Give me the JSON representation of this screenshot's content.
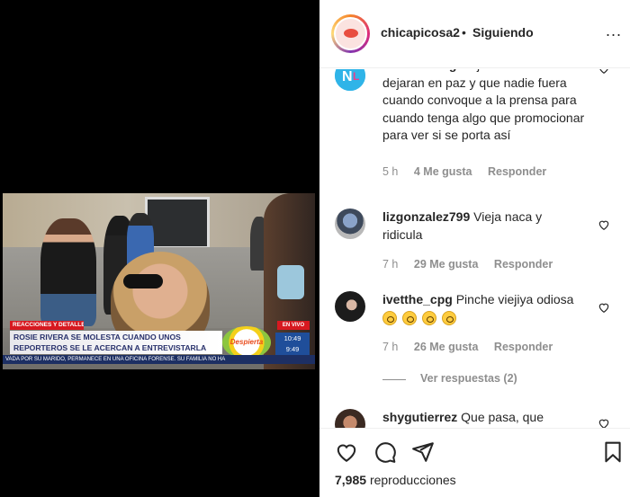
{
  "video": {
    "section_label": "REACCIONES Y DETALLES",
    "live_label": "EN VIVO",
    "headline": "ROSIE RIVERA SE MOLESTA CUANDO UNOS REPORTEROS SE LE ACERCAN A ENTREVISTARLA",
    "show_logo": "Despierta",
    "clock_time": "10:49",
    "clock_temp": "9:49",
    "ticker": "VADA POR SU MARIDO, PERMANECE EN UNA OFICINA FORENSE. SU FAMILIA NO HA"
  },
  "post": {
    "username": "chicapicosa2",
    "separator": "•",
    "follow_label": "Siguiendo",
    "more_label": "...",
    "views_count": "7,985",
    "views_label": "reproducciones"
  },
  "comments": [
    {
      "user": "novelalounge",
      "text": "Ojalá un día si la dejaran en paz y que nadie fuera cuando convoque a la prensa para cuando tenga algo que promocionar para ver si se porta así",
      "time": "5 h",
      "likes": "4 Me gusta",
      "reply": "Responder"
    },
    {
      "user": "lizgonzalez799",
      "text": "Vieja naca y ridicula",
      "time": "7 h",
      "likes": "29 Me gusta",
      "reply": "Responder"
    },
    {
      "user": "ivetthe_cpg",
      "text": "Pinche viejiya odiosa",
      "time": "7 h",
      "likes": "26 Me gusta",
      "reply": "Responder",
      "view_replies": "Ver respuestas (2)"
    },
    {
      "user": "shygutierrez",
      "text": "Que pasa, que"
    }
  ],
  "colors": {
    "text": "#262626",
    "meta": "#8e8e8e",
    "news_red": "#d71920",
    "news_blue": "#1d2f63"
  }
}
